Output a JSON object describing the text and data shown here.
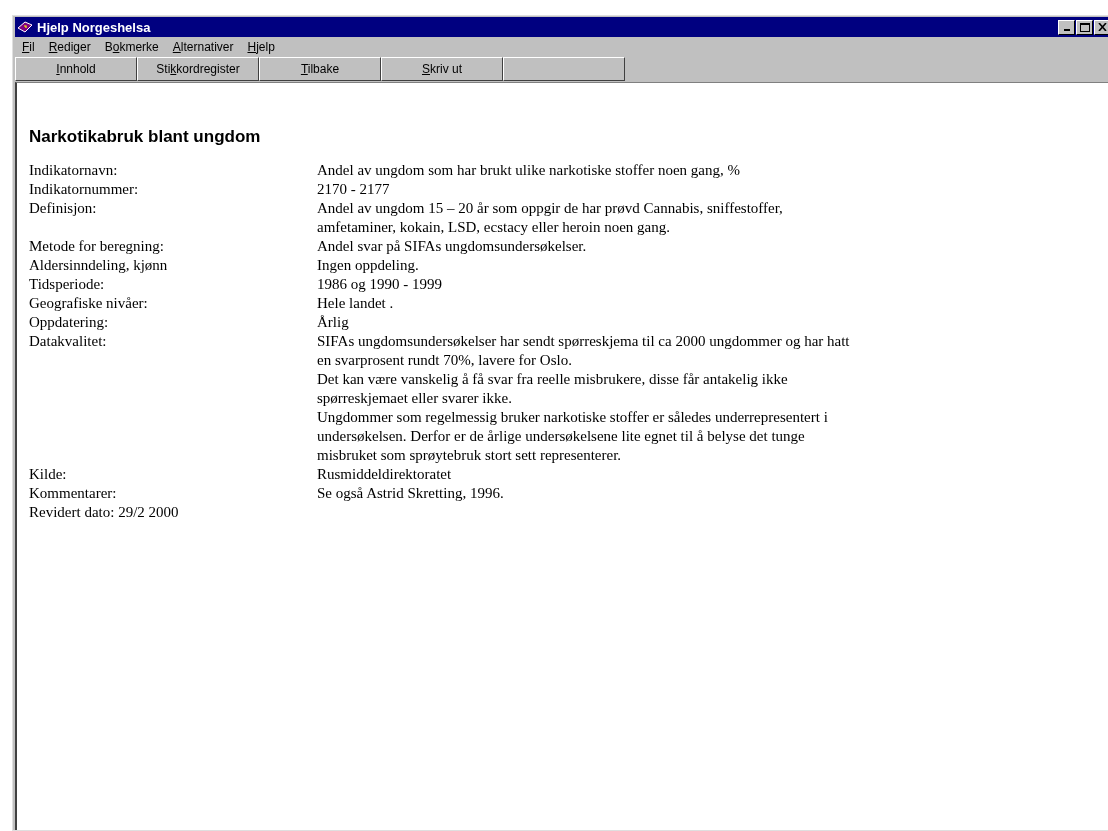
{
  "window": {
    "title": "Hjelp Norgeshelsa"
  },
  "menu": [
    {
      "key": "F",
      "after": "il"
    },
    {
      "key": "R",
      "after": "ediger"
    },
    {
      "before": "B",
      "key": "o",
      "after": "kmerke"
    },
    {
      "key": "A",
      "after": "lternativer"
    },
    {
      "key": "H",
      "after": "jelp"
    }
  ],
  "toolbar": [
    {
      "key": "I",
      "after": "nnhold"
    },
    {
      "before": "Sti",
      "key": "k",
      "after": "kordregister"
    },
    {
      "key": "T",
      "after": "ilbake"
    },
    {
      "key": "S",
      "after": "kriv ut"
    }
  ],
  "heading": "Narkotikabruk blant ungdom",
  "rows": [
    {
      "label": "Indikatornavn:",
      "value": [
        "Andel av ungdom som har brukt ulike narkotiske stoffer noen gang, %"
      ]
    },
    {
      "label": "Indikatornummer:",
      "value": [
        "2170 - 2177"
      ]
    },
    {
      "label": "Definisjon:",
      "value": [
        "Andel av ungdom 15 – 20 år som oppgir de har prøvd Cannabis, sniffestoffer, amfetaminer, kokain, LSD, ecstacy eller heroin noen gang."
      ]
    },
    {
      "label": "Metode for beregning:",
      "value": [
        "Andel svar på SIFAs ungdomsundersøkelser."
      ]
    },
    {
      "label": "Aldersinndeling, kjønn",
      "value": [
        "Ingen oppdeling."
      ]
    },
    {
      "label": "Tidsperiode:",
      "value": [
        "1986 og 1990 - 1999"
      ]
    },
    {
      "label": "Geografiske nivåer:",
      "value": [
        "Hele landet ."
      ]
    },
    {
      "label": "Oppdatering:",
      "value": [
        "Årlig"
      ]
    },
    {
      "label": "Datakvalitet:",
      "value": [
        "SIFAs ungdomsundersøkelser har sendt spørreskjema til ca 2000 ungdommer og har hatt en svarprosent rundt 70%, lavere for Oslo.",
        "Det kan være vanskelig å få svar fra reelle misbrukere, disse får antakelig ikke spørreskjemaet eller svarer ikke.",
        "Ungdommer som regelmessig bruker narkotiske stoffer er således underrepresentert i undersøkelsen. Derfor er de årlige undersøkelsene lite egnet til å belyse det tunge misbruket som sprøytebruk stort sett representerer."
      ]
    },
    {
      "label": "Kilde:",
      "value": [
        "Rusmiddeldirektoratet"
      ]
    },
    {
      "label": "Kommentarer:",
      "value": [
        "Se også Astrid Skretting, 1996."
      ]
    }
  ],
  "revised": "Revidert dato: 29/2 2000"
}
